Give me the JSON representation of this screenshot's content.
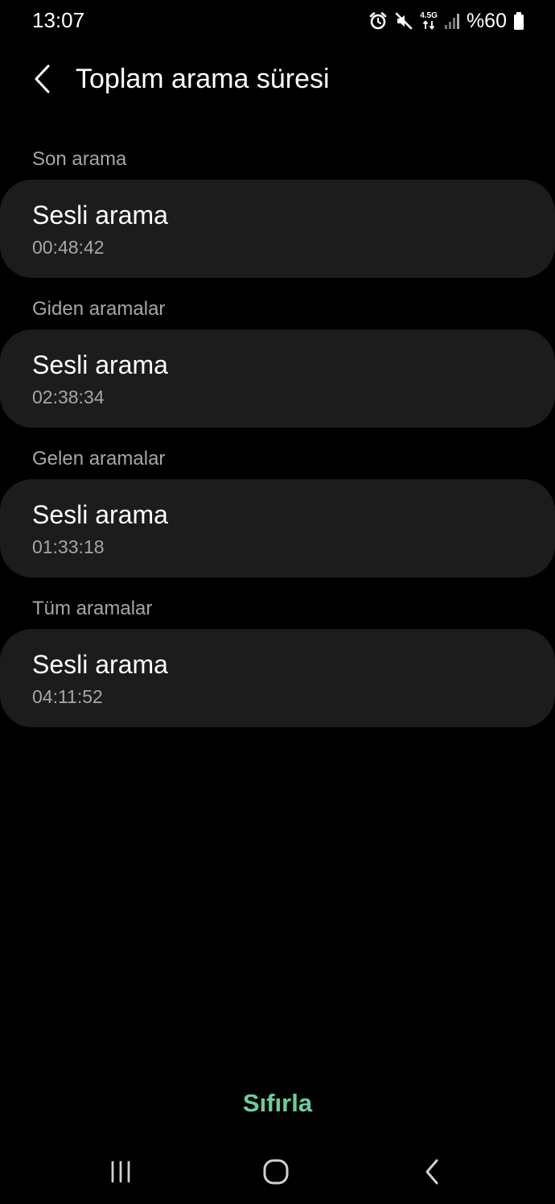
{
  "status_bar": {
    "time": "13:07",
    "network_label": "4.5G",
    "battery": "%60",
    "icons": [
      "alarm-icon",
      "mute-icon",
      "data-arrows-icon",
      "signal-icon",
      "battery-icon"
    ]
  },
  "header": {
    "back_icon": "chevron-left-icon",
    "title": "Toplam arama süresi"
  },
  "sections": [
    {
      "label": "Son arama",
      "item_title": "Sesli arama",
      "item_value": "00:48:42"
    },
    {
      "label": "Giden aramalar",
      "item_title": "Sesli arama",
      "item_value": "02:38:34"
    },
    {
      "label": "Gelen aramalar",
      "item_title": "Sesli arama",
      "item_value": "01:33:18"
    },
    {
      "label": "Tüm aramalar",
      "item_title": "Sesli arama",
      "item_value": "04:11:52"
    }
  ],
  "reset_label": "Sıfırla",
  "nav_bar": {
    "icons": [
      "recent-apps-icon",
      "home-icon",
      "back-icon"
    ]
  },
  "colors": {
    "background": "#000000",
    "card": "#1c1c1c",
    "secondary_text": "#a6a6a6",
    "accent": "#6fcb9f"
  }
}
